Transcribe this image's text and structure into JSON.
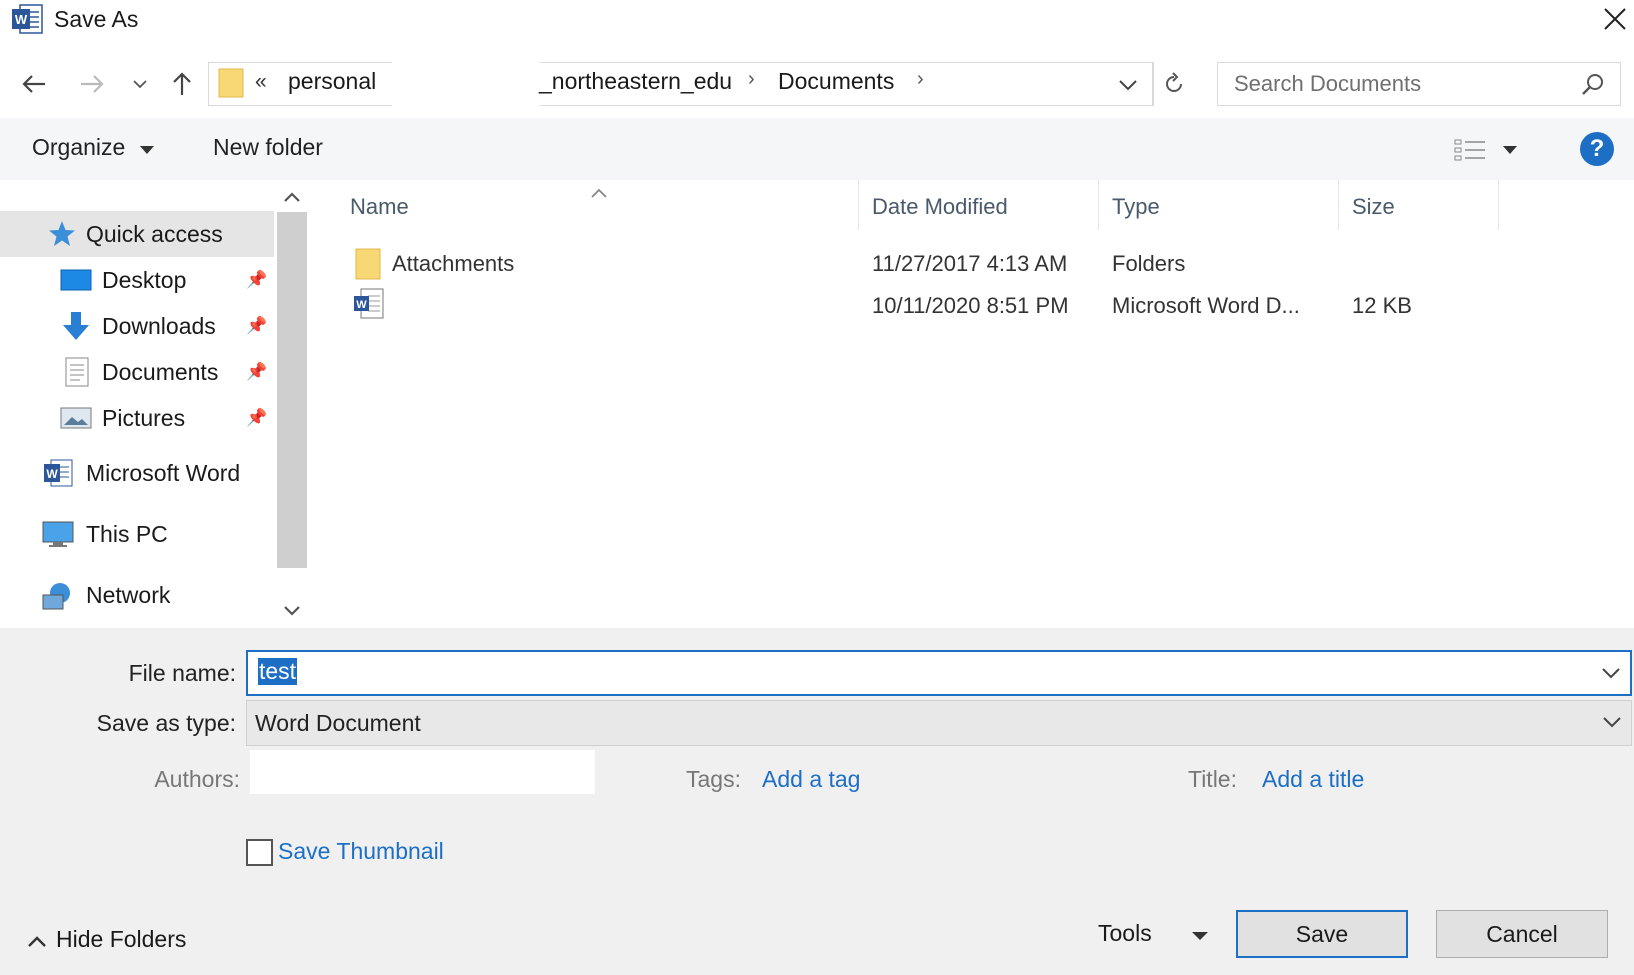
{
  "window": {
    "title": "Save As"
  },
  "nav": {
    "breadcrumb": {
      "overflow": "«",
      "segments": [
        "personal",
        "_northeastern_edu",
        "Documents"
      ],
      "separator": "›"
    },
    "search_placeholder": "Search Documents"
  },
  "toolbar": {
    "organize": "Organize",
    "new_folder": "New folder",
    "help": "?"
  },
  "sidebar": {
    "items": [
      {
        "label": "Quick access",
        "icon": "star-icon",
        "pinned": false
      },
      {
        "label": "Desktop",
        "icon": "desktop-icon",
        "pinned": true
      },
      {
        "label": "Downloads",
        "icon": "download-icon",
        "pinned": true
      },
      {
        "label": "Documents",
        "icon": "documents-icon",
        "pinned": true
      },
      {
        "label": "Pictures",
        "icon": "pictures-icon",
        "pinned": true
      },
      {
        "label": "Microsoft Word",
        "icon": "word-icon",
        "pinned": false
      },
      {
        "label": "This PC",
        "icon": "pc-icon",
        "pinned": false
      },
      {
        "label": "Network",
        "icon": "network-icon",
        "pinned": false
      }
    ]
  },
  "files": {
    "columns": [
      "Name",
      "Date Modified",
      "Type",
      "Size"
    ],
    "rows": [
      {
        "name": "Attachments",
        "icon": "folder-icon",
        "date": "11/27/2017 4:13 AM",
        "type": "Folders",
        "size": ""
      },
      {
        "name": "",
        "icon": "word-doc-icon",
        "date": "10/11/2020 8:51 PM",
        "type": "Microsoft Word D...",
        "size": "12 KB"
      }
    ]
  },
  "form": {
    "file_name_label": "File name:",
    "file_name_value": "test",
    "save_type_label": "Save as type:",
    "save_type_value": "Word Document",
    "authors_label": "Authors:",
    "tags_label": "Tags:",
    "tags_link": "Add a tag",
    "title_label": "Title:",
    "title_link": "Add a title",
    "save_thumbnail": "Save Thumbnail"
  },
  "footer": {
    "hide_folders": "Hide Folders",
    "tools": "Tools",
    "save": "Save",
    "cancel": "Cancel"
  },
  "colors": {
    "accent": "#1c6fc5",
    "folder": "#f8d775",
    "word": "#2b579a"
  }
}
